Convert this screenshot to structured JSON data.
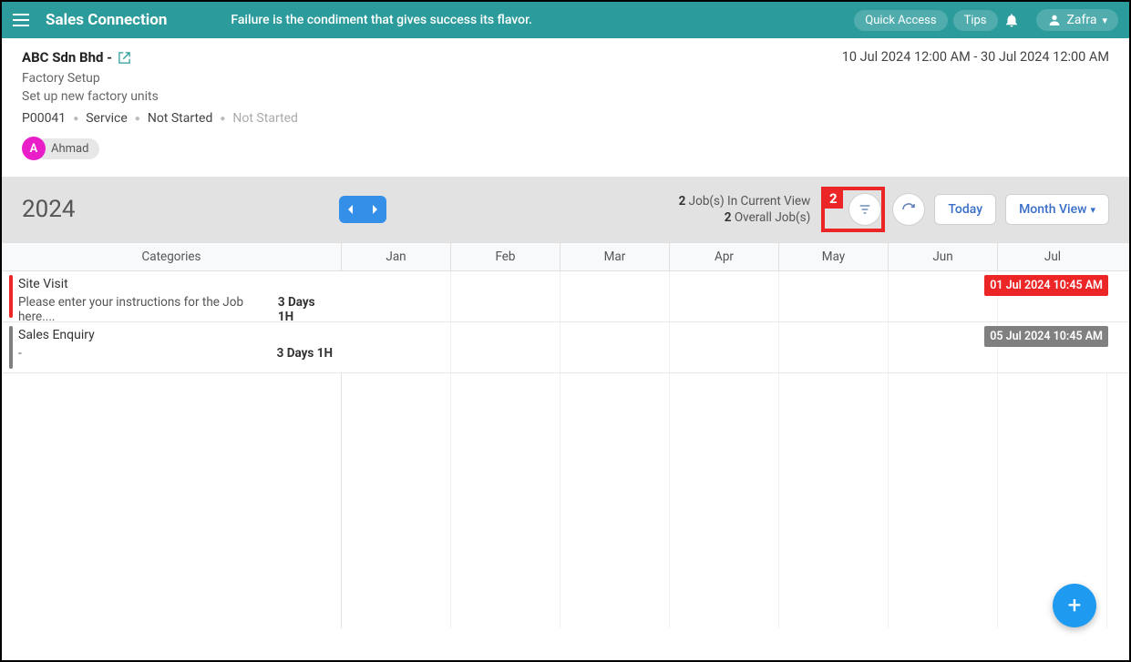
{
  "header": {
    "brand": "Sales Connection",
    "quote": "Failure is the condiment that gives success its flavor.",
    "quick_access": "Quick Access",
    "tips": "Tips",
    "user_name": "Zafra"
  },
  "project": {
    "company": "ABC Sdn Bhd -",
    "date_range": "10 Jul 2024 12:00 AM - 30 Jul 2024 12:00 AM",
    "title": "Factory Setup",
    "subtitle": "Set up new factory units",
    "code": "P00041",
    "type": "Service",
    "status1": "Not Started",
    "status2": "Not Started",
    "assignee_initial": "A",
    "assignee_name": "Ahmad"
  },
  "toolbar": {
    "year": "2024",
    "stats_count1": "2",
    "stats_text1": " Job(s) In Current View",
    "stats_count2": "2",
    "stats_text2": " Overall Job(s)",
    "today": "Today",
    "view_label": "Month View",
    "callout_num": "2"
  },
  "table": {
    "cat_header": "Categories",
    "months": [
      "Jan",
      "Feb",
      "Mar",
      "Apr",
      "May",
      "Jun",
      "Jul"
    ]
  },
  "rows": [
    {
      "bar_class": "site",
      "title": "Site Visit",
      "sub": "Please enter your instructions for the Job here....",
      "dur": "3 Days 1H",
      "event_class": "red",
      "event_text": "01 Jul 2024 10:45 AM"
    },
    {
      "bar_class": "enq",
      "title": "Sales Enquiry",
      "sub": "-",
      "dur": "3 Days 1H",
      "event_class": "grey",
      "event_text": "05 Jul 2024 10:45 AM"
    }
  ]
}
